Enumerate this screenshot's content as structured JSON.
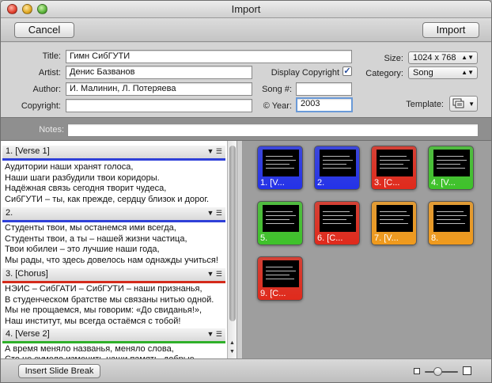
{
  "window": {
    "title": "Import"
  },
  "toolbar": {
    "cancel_label": "Cancel",
    "import_label": "Import"
  },
  "form": {
    "title_label": "Title:",
    "title_value": "Гимн СибГУТИ",
    "artist_label": "Artist:",
    "artist_value": "Денис Базванов",
    "author_label": "Author:",
    "author_value": "И. Малинин, Л. Потеряева",
    "copyright_label": "Copyright:",
    "copyright_value": "",
    "display_copyright_label": "Display Copyright",
    "display_copyright_checked": "✓",
    "song_label": "Song #:",
    "song_value": "",
    "year_label": "© Year:",
    "year_value": "2003",
    "size_label": "Size:",
    "size_value": "1024 x 768",
    "category_label": "Category:",
    "category_value": "Song",
    "template_label": "Template:",
    "notes_label": "Notes:",
    "notes_value": ""
  },
  "verses": [
    {
      "header": "1. [Verse 1]",
      "color": "#2f40d8",
      "lines": [
        "Аудитории наши хранят голоса,",
        "Наши шаги разбудили твои коридоры.",
        "Надёжная связь сегодня творит чудеса,",
        "СибГУТИ – ты, как прежде, сердцу близок и дорог."
      ]
    },
    {
      "header": "2.",
      "color": "#2f40d8",
      "lines": [
        "Студенты твои, мы останемся ими всегда,",
        "Студенты твои, а ты – нашей жизни частица,",
        "Твои юбилеи – это лучшие наши года,",
        "Мы рады, что здесь довелось нам однажды учиться!"
      ]
    },
    {
      "header": "3. [Chorus]",
      "color": "#d42a1a",
      "lines": [
        "НЭИС – СибГАТИ – СибГУТИ – наши признанья,",
        "В студенческом братстве мы связаны нитью одной.",
        "Мы не прощаемся, мы говорим: «До свиданья!»,",
        "Наш институт, мы всегда остаёмся с тобой!"
      ]
    },
    {
      "header": "4. [Verse 2]",
      "color": "#2fb02a",
      "lines": [
        "А время меняло названья, меняло слова,",
        "Сто не сумело изменить наши память, добрые"
      ]
    }
  ],
  "slides": [
    {
      "caption": "1. [V...",
      "color": "#2432e8"
    },
    {
      "caption": "2.",
      "color": "#2432e8"
    },
    {
      "caption": "3. [C...",
      "color": "#e02a1c"
    },
    {
      "caption": "4. [V...",
      "color": "#3ec22a"
    },
    {
      "caption": "5.",
      "color": "#3ec22a"
    },
    {
      "caption": "6. [C...",
      "color": "#e02a1c"
    },
    {
      "caption": "7. [V...",
      "color": "#f09a1c"
    },
    {
      "caption": "8.",
      "color": "#f09a1c"
    },
    {
      "caption": "9. [C...",
      "color": "#e02a1c"
    }
  ],
  "bottom": {
    "insert_break_label": "Insert Slide Break"
  }
}
